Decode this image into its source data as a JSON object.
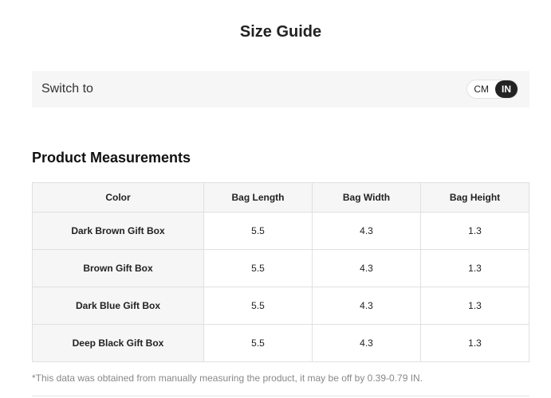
{
  "header": {
    "title": "Size Guide"
  },
  "switch": {
    "label": "Switch to",
    "options": [
      "CM",
      "IN"
    ],
    "selected": "IN"
  },
  "section": {
    "title": "Product Measurements"
  },
  "table": {
    "columns": [
      "Color",
      "Bag Length",
      "Bag Width",
      "Bag Height"
    ],
    "rows": [
      [
        "Dark Brown Gift Box",
        "5.5",
        "4.3",
        "1.3"
      ],
      [
        "Brown Gift Box",
        "5.5",
        "4.3",
        "1.3"
      ],
      [
        "Dark Blue Gift Box",
        "5.5",
        "4.3",
        "1.3"
      ],
      [
        "Deep Black Gift Box",
        "5.5",
        "4.3",
        "1.3"
      ]
    ]
  },
  "footnote": "*This data was obtained from manually measuring the product, it may be off by 0.39-0.79 IN."
}
